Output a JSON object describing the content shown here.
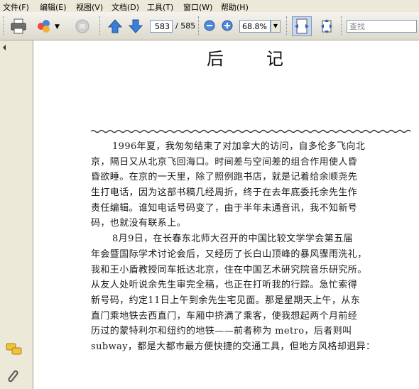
{
  "menu": [
    "文件(F)",
    "编辑(E)",
    "视图(V)",
    "文档(D)",
    "工具(T)",
    "窗口(W)",
    "帮助(H)"
  ],
  "toolbar": {
    "current_page": "583",
    "total_pages": "/ 585",
    "zoom": "68.8%",
    "search_placeholder": "查找"
  },
  "document": {
    "title": "后记",
    "lines": [
      "1996年夏，我匆匆结束了对加拿大的访问，自多伦多飞向北",
      "京，隔日又从北京飞回海口。时间差与空间差的组合作用使人昏",
      "昏欲睡。在京的一天里，除了照例跑书店，就是记着给余顺尧先",
      "生打电话，因为这部书稿几经周折，终于在去年底委托余先生作",
      "责任编辑。谁知电话号码变了，由于半年未通音讯，我不知新号",
      "码，也就没有联系上。",
      "8月9日，在长春东北师大召开的中国比较文学学会第五届",
      "年会暨国际学术讨论会后，又经历了长白山顶峰的暴风骤雨洗礼，",
      "我和王小盾教授同车抵达北京，住在中国艺术研究院音乐研究所。",
      "从友人处听说余先生审完全稿，也正在打听我的行踪。急忙索得",
      "新号码，约定11日上午到余先生宅见面。那是星期天上午，从东",
      "直门乘地铁去西直门，车厢中挤满了乘客，使我想起两个月前经",
      "历过的蒙特利尔和纽约的地铁——前者称为 metro，后者则叫",
      "subway，都是大都市最方便快捷的交通工具，但地方风格却迥异："
    ]
  }
}
